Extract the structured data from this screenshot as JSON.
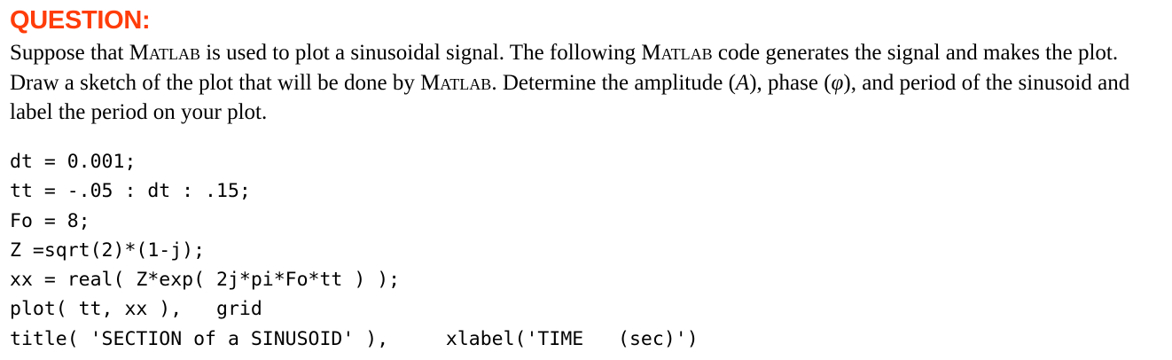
{
  "heading": {
    "label": "QUESTION:",
    "color": "#ff3d0a"
  },
  "question": {
    "t1": "Suppose that ",
    "matlab_1": "Matlab",
    "t2": " is used to plot a sinusoidal signal. The following ",
    "matlab_2": "Matlab",
    "t3": " code generates the signal and makes the plot. Draw a sketch of the plot that will be done by ",
    "matlab_3": "Matlab",
    "t4": ". Determine the amplitude (",
    "amp_symbol": "A",
    "t5": "), phase (",
    "phase_symbol": "φ",
    "t6": "), and period of the sinusoid and label the period on your plot."
  },
  "code": {
    "lines": [
      "dt = 0.001;",
      "tt = -.05 : dt : .15;",
      "Fo = 8;",
      "Z =sqrt(2)*(1-j);",
      "xx = real( Z*exp( 2j*pi*Fo*tt ) );",
      "plot( tt, xx ),   grid",
      "title( 'SECTION of a SINUSOID' ),     xlabel('TIME   (sec)')"
    ]
  }
}
